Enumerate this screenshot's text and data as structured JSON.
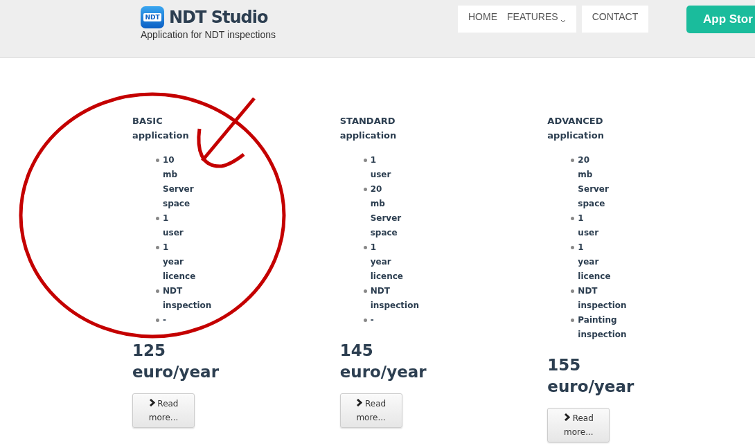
{
  "header": {
    "logo_icon_text": "NDT",
    "title": "NDT Studio",
    "tagline": "Application for NDT inspections"
  },
  "nav_groups": [
    [
      {
        "label": "HOME",
        "kind": "link"
      },
      {
        "label": "FEATURES",
        "kind": "dropdown"
      }
    ],
    [
      {
        "label": "CONTACT",
        "kind": "link"
      }
    ]
  ],
  "cta": {
    "label": "App Stor"
  },
  "plans": [
    {
      "name": "BASIC",
      "subtitle": "application",
      "features": [
        "10 mb Server space",
        "1 user",
        "1 year licence",
        "NDT inspection",
        "-"
      ],
      "price": "125",
      "period": "euro/year",
      "button": "Read more..."
    },
    {
      "name": "STANDARD",
      "subtitle": "application",
      "features": [
        "1 user",
        "20 mb Server space",
        "1 year licence",
        "NDT inspection",
        "-"
      ],
      "price": "145",
      "period": "euro/year",
      "button": "Read more..."
    },
    {
      "name": "ADVANCED",
      "subtitle": "application",
      "features": [
        "20 mb Server space",
        "1 user",
        "1 year licence",
        "NDT inspection",
        "Painting inspection"
      ],
      "price": "155",
      "period": "euro/year",
      "button": "Read more..."
    }
  ]
}
